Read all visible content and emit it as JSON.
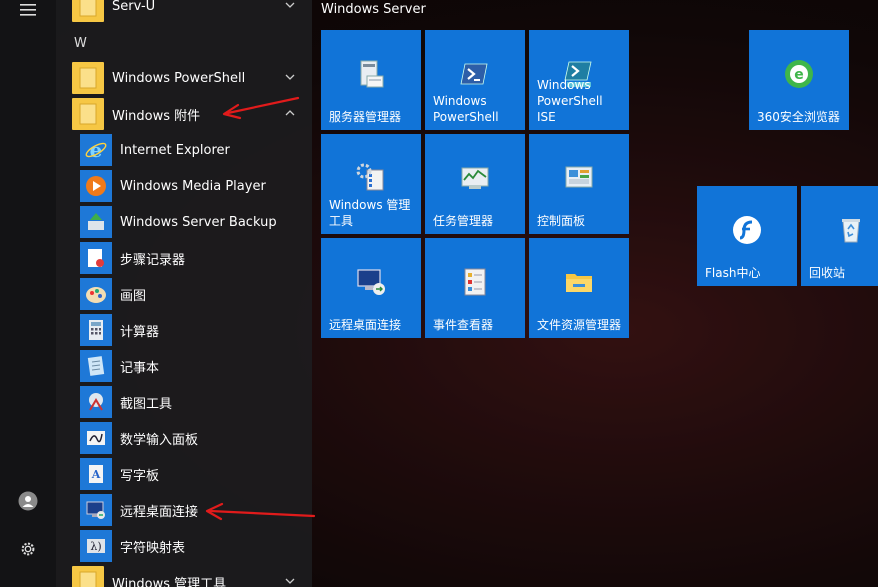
{
  "start_menu": {
    "letter_w": "W",
    "apps": [
      {
        "label": "Serv-U",
        "type": "folder",
        "expanded": false
      },
      {
        "label": "Windows PowerShell",
        "type": "folder",
        "expanded": false
      },
      {
        "label": "Windows 附件",
        "type": "folder",
        "expanded": true
      },
      {
        "label": "Internet Explorer",
        "type": "app",
        "icon": "ie-icon"
      },
      {
        "label": "Windows Media Player",
        "type": "app",
        "icon": "media-player-icon"
      },
      {
        "label": "Windows Server Backup",
        "type": "app",
        "icon": "backup-icon"
      },
      {
        "label": "步骤记录器",
        "type": "app",
        "icon": "steps-recorder-icon"
      },
      {
        "label": "画图",
        "type": "app",
        "icon": "paint-icon"
      },
      {
        "label": "计算器",
        "type": "app",
        "icon": "calculator-icon"
      },
      {
        "label": "记事本",
        "type": "app",
        "icon": "notepad-icon"
      },
      {
        "label": "截图工具",
        "type": "app",
        "icon": "snipping-icon"
      },
      {
        "label": "数学输入面板",
        "type": "app",
        "icon": "math-input-icon"
      },
      {
        "label": "写字板",
        "type": "app",
        "icon": "wordpad-icon"
      },
      {
        "label": "远程桌面连接",
        "type": "app",
        "icon": "remote-desktop-icon"
      },
      {
        "label": "字符映射表",
        "type": "app",
        "icon": "charmap-icon"
      },
      {
        "label": "Windows 管理工具",
        "type": "folder",
        "expanded": false
      }
    ]
  },
  "tiles": {
    "group_title": "Windows Server",
    "items": [
      {
        "label": "服务器管理器",
        "icon": "server-manager-icon"
      },
      {
        "label": "Windows PowerShell",
        "icon": "powershell-icon"
      },
      {
        "label": "Windows PowerShell ISE",
        "icon": "powershell-ise-icon"
      },
      {
        "label": "360安全浏览器",
        "icon": "browser-360-icon"
      },
      {
        "label": "Windows 管理工具",
        "icon": "admin-tools-icon"
      },
      {
        "label": "任务管理器",
        "icon": "task-manager-icon"
      },
      {
        "label": "控制面板",
        "icon": "control-panel-icon"
      },
      {
        "label": "Flash中心",
        "icon": "flash-icon"
      },
      {
        "label": "回收站",
        "icon": "recycle-bin-icon"
      },
      {
        "label": "远程桌面连接",
        "icon": "remote-desktop-icon"
      },
      {
        "label": "事件查看器",
        "icon": "event-viewer-icon"
      },
      {
        "label": "文件资源管理器",
        "icon": "file-explorer-icon"
      }
    ]
  },
  "colors": {
    "tile_blue": "#1174d8",
    "annotation_red": "#e11b1b",
    "folder_yellow": "#f6c744"
  }
}
